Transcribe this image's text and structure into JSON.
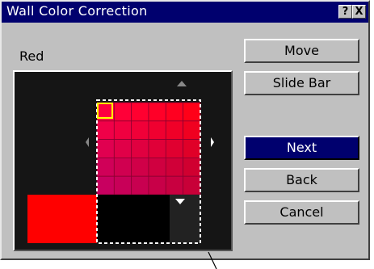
{
  "window": {
    "title": "Wall Color Correction",
    "help_button": "?",
    "close_button": "X"
  },
  "color_label": "Red",
  "buttons": {
    "move": "Move",
    "slide_bar": "Slide Bar",
    "next": "Next",
    "back": "Back",
    "cancel": "Cancel"
  },
  "grid": {
    "rows": 5,
    "cols": 6,
    "selected_cell": {
      "row": 0,
      "col": 0
    },
    "colors": [
      [
        "#ff0040",
        "#ff0038",
        "#ff0030",
        "#ff0028",
        "#ff0020",
        "#ff0018"
      ],
      [
        "#f00048",
        "#f00040",
        "#f00038",
        "#f00030",
        "#f00028",
        "#f00020"
      ],
      [
        "#e00050",
        "#e00048",
        "#e00040",
        "#e00038",
        "#e00030",
        "#e00028"
      ],
      [
        "#d00058",
        "#d00050",
        "#d00048",
        "#d00040",
        "#d00038",
        "#d00030"
      ],
      [
        "#c80060",
        "#c80058",
        "#c80050",
        "#c80048",
        "#c80040",
        "#c80038"
      ]
    ]
  },
  "preview_color": "#ff0000",
  "accent_colors": {
    "titlebar": "#00006e",
    "active_button": "#00006e",
    "selection": "#ffff00"
  },
  "icons": [
    "arrow-up-icon",
    "arrow-left-icon",
    "arrow-right-icon",
    "arrow-down-icon"
  ]
}
